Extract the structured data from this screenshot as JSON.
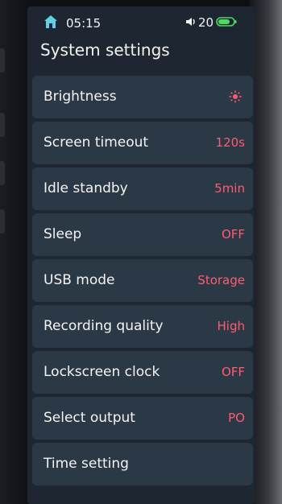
{
  "status_bar": {
    "time": "05:15",
    "volume": "20",
    "icons": [
      "home-icon",
      "speaker-icon",
      "battery-icon"
    ]
  },
  "title": "System settings",
  "accent_color": "#ff5c73",
  "battery_color": "#4cd964",
  "items": [
    {
      "label": "Brightness",
      "icon": "brightness-icon"
    },
    {
      "label": "Screen timeout",
      "value": "120s"
    },
    {
      "label": "Idle standby",
      "value": "5min"
    },
    {
      "label": "Sleep",
      "value": "OFF"
    },
    {
      "label": "USB mode",
      "value": "Storage"
    },
    {
      "label": "Recording quality",
      "value": "High"
    },
    {
      "label": "Lockscreen clock",
      "value": "OFF"
    },
    {
      "label": "Select output",
      "value": "PO"
    },
    {
      "label": "Time setting"
    }
  ]
}
